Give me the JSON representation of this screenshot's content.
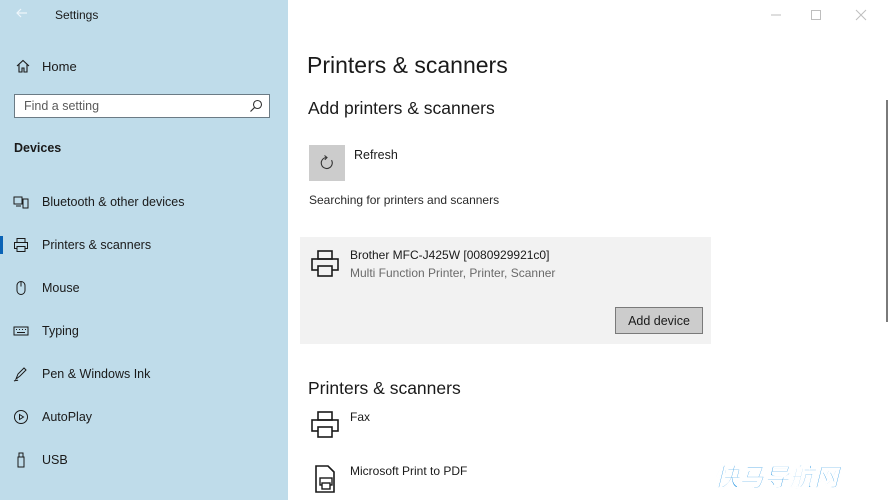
{
  "window": {
    "title": "Settings"
  },
  "sidebar": {
    "home_label": "Home",
    "search_placeholder": "Find a setting",
    "section_label": "Devices",
    "items": [
      {
        "label": "Bluetooth & other devices",
        "icon": "bluetooth-devices-icon",
        "active": false
      },
      {
        "label": "Printers & scanners",
        "icon": "printer-icon",
        "active": true
      },
      {
        "label": "Mouse",
        "icon": "mouse-icon",
        "active": false
      },
      {
        "label": "Typing",
        "icon": "keyboard-icon",
        "active": false
      },
      {
        "label": "Pen & Windows Ink",
        "icon": "pen-icon",
        "active": false
      },
      {
        "label": "AutoPlay",
        "icon": "autoplay-icon",
        "active": false
      },
      {
        "label": "USB",
        "icon": "usb-icon",
        "active": false
      }
    ]
  },
  "main": {
    "page_title": "Printers & scanners",
    "add_section_title": "Add printers & scanners",
    "refresh_label": "Refresh",
    "searching_text": "Searching for printers and scanners",
    "found_device": {
      "name": "Brother MFC-J425W [0080929921c0]",
      "description": "Multi Function Printer, Printer, Scanner",
      "add_button_label": "Add device"
    },
    "installed_section_title": "Printers & scanners",
    "installed": [
      {
        "label": "Fax",
        "icon": "fax-printer-icon"
      },
      {
        "label": "Microsoft Print to PDF",
        "icon": "pdf-printer-icon"
      }
    ]
  },
  "colors": {
    "sidebar_bg": "#bfdcea",
    "accent": "#0a63b6",
    "card_bg": "#f2f2f2",
    "button_bg": "#cccccc",
    "watermark": "#1a8fe0"
  },
  "watermark": {
    "text": "快马导航网"
  }
}
